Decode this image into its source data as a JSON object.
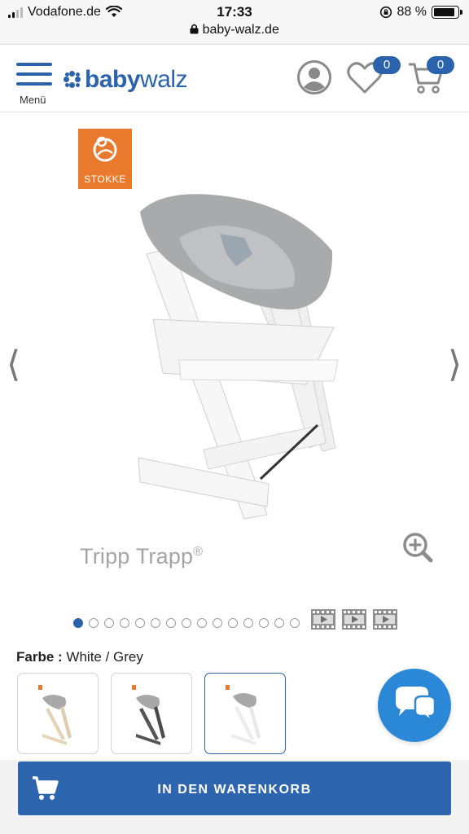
{
  "status_bar": {
    "carrier": "Vodafone.de",
    "time": "17:33",
    "url": "baby-walz.de",
    "battery": "88 %"
  },
  "header": {
    "menu_label": "Menü",
    "logo_left": "baby",
    "logo_right": "walz",
    "wishlist_count": "0",
    "cart_count": "0"
  },
  "product": {
    "brand": "STOKKE",
    "image_caption": "Tripp Trapp",
    "trademark": "®",
    "prev_arrow": "⟨",
    "next_arrow": "⟩",
    "image_dots": 15,
    "active_dot": 1,
    "videos": 3
  },
  "color": {
    "label": "Farbe :",
    "value": "White / Grey"
  },
  "cart_button": {
    "label": "IN DEN WARENKORB"
  },
  "colors": {
    "brand_blue": "#2a63ab",
    "button_blue": "#2d66ae",
    "chat_blue": "#2a88d6",
    "stokke_orange": "#e97a2d"
  }
}
